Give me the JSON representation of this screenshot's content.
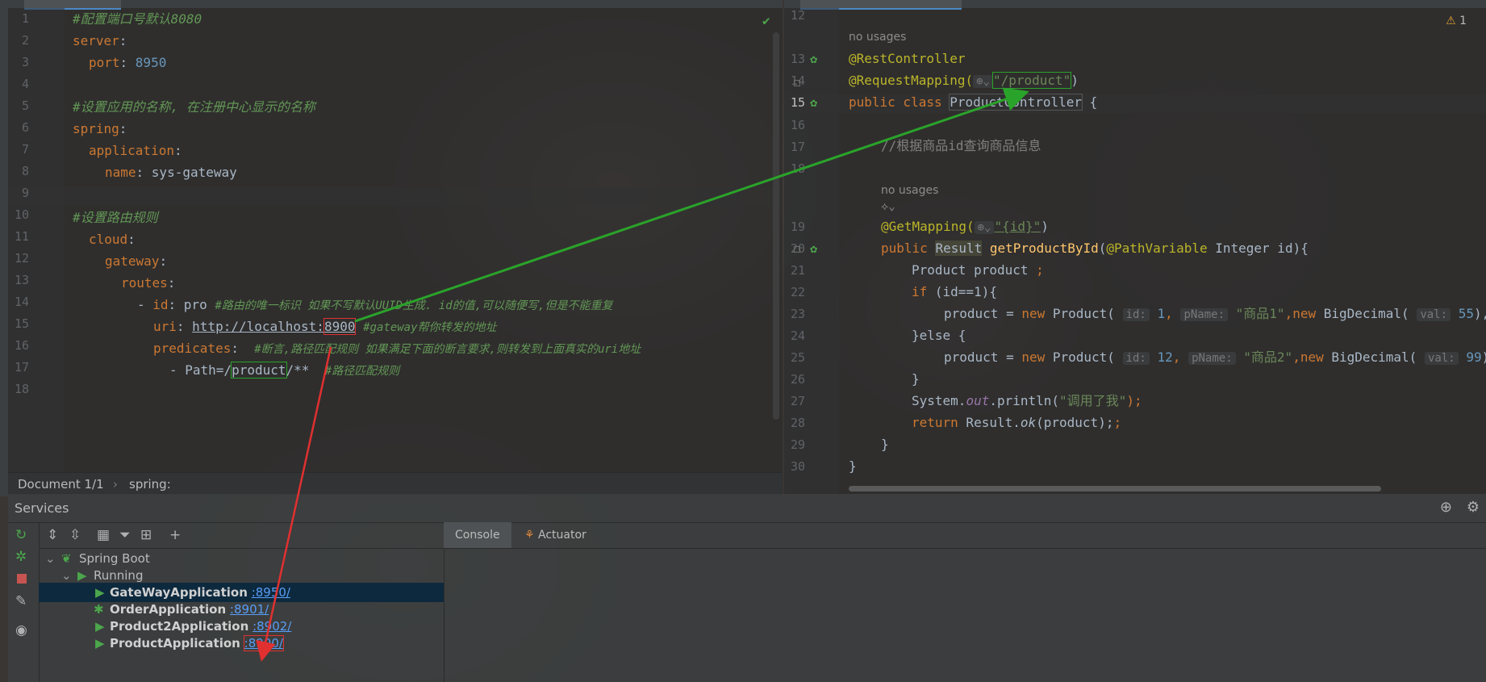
{
  "left_editor": {
    "line_numbers": [
      "1",
      "2",
      "3",
      "4",
      "5",
      "6",
      "7",
      "8",
      "9",
      "10",
      "11",
      "12",
      "13",
      "14",
      "15",
      "16",
      "17",
      "18"
    ],
    "l1_comment": "#配置端口号默认8080",
    "l2_key": "server",
    "l3_key": "port",
    "l3_value": "8950",
    "l5_comment": "#设置应用的名称, 在注册中心显示的名称",
    "l6_key": "spring",
    "l7_key": "application",
    "l8_key": "name",
    "l8_value": "sys-gateway",
    "l10_comment": "#设置路由规则",
    "l11_key": "cloud",
    "l12_key": "gateway",
    "l13_key": "routes",
    "l14_dash": "- ",
    "l14_key": "id",
    "l14_value": "pro",
    "l14_comment": "#路由的唯一标识 如果不写默认UUID生成. id的值,可以随便写,但是不能重复",
    "l15_key": "uri",
    "l15_url_prefix": "http://localhost:",
    "l15_port": "8900",
    "l15_comment": "#gateway帮你转发的地址",
    "l16_key": "predicates",
    "l16_comment": "#断言,路径匹配规则 如果满足下面的断言要求,则转发到上面真实的uri地址",
    "l17_prefix": "- Path=/",
    "l17_path": "product",
    "l17_suffix": "/**",
    "l17_comment": "#路径匹配规则"
  },
  "breadcrumb": {
    "document": "Document 1/1",
    "separator": "›",
    "section": "spring:"
  },
  "right_editor": {
    "warning_count": "1",
    "line_numbers": {
      "l12": "12",
      "l13": "13",
      "l14": "14",
      "l15": "15",
      "l16": "16",
      "l17": "17",
      "l18": "18",
      "l19": "19",
      "l20": "20",
      "l21": "21",
      "l22": "22",
      "l23": "23",
      "l24": "24",
      "l25": "25",
      "l26": "26",
      "l27": "27",
      "l28": "28",
      "l29": "29",
      "l30": "30"
    },
    "no_usages": "no usages",
    "no_usages_2": "no usages",
    "rest_controller": "@RestController",
    "request_mapping": "@RequestMapping(",
    "request_mapping_path": "\"/product\"",
    "request_mapping_close": ")",
    "class_kw": "public class ",
    "class_name": "ProductController",
    "class_open": " {",
    "comment_query": "//根据商品id查询商品信息",
    "get_mapping": "@GetMapping(",
    "get_mapping_path": "\"{id}\"",
    "get_mapping_close": ")",
    "l20_public": "public ",
    "l20_type": "Result",
    "l20_method": "getProductById",
    "l20_params_a": "(",
    "l20_ann": "@PathVariable",
    "l20_params_b": " Integer id){",
    "l21_text": "Product product ",
    "l21_semicolon": ";",
    "l22_if": "if",
    "l22_rest": " (id==1){",
    "l23_lead": "product = ",
    "l23_new": "new",
    "l23_ctor": " Product(",
    "l23_hint_id": "id:",
    "l23_id": "1",
    "l23_hint_pname": "pName:",
    "l23_str": "\"商品1\"",
    "l23_new2": ",new",
    "l23_bd": " BigDecimal(",
    "l23_hint_val": "val:",
    "l23_val": "55",
    "l23_tail": "), in",
    "l24_text": "}else {",
    "l25_lead": "product = ",
    "l25_new": "new",
    "l25_ctor": " Product(",
    "l25_hint_id": "id:",
    "l25_id": "12",
    "l25_hint_pname": "pName:",
    "l25_str": "\"商品2\"",
    "l25_new2": ",new",
    "l25_bd": " BigDecimal(",
    "l25_hint_val": "val:",
    "l25_val": "99",
    "l25_tail": "),",
    "l26_text": "}",
    "l27_a": "System.",
    "l27_out": "out",
    "l27_b": ".println(",
    "l27_str": "\"调用了我\"",
    "l27_c": ");",
    "l28_return": "return",
    "l28_a": " Result.",
    "l28_ok": "ok",
    "l28_b": "(product);",
    "l29_text": "}",
    "l30_text": "}"
  },
  "services": {
    "title": "Services",
    "tree": [
      {
        "label": "Spring Boot"
      },
      {
        "label": "Running"
      },
      {
        "name": "GateWayApplication",
        "port": ":8950/"
      },
      {
        "name": "OrderApplication",
        "port": ":8901/"
      },
      {
        "name": "Product2Application",
        "port": ":8902/"
      },
      {
        "name": "ProductApplication",
        "port": ":8900/"
      }
    ],
    "tabs": {
      "console": "Console",
      "actuator": "Actuator"
    }
  },
  "colors": {
    "annotation_red": "#e03030",
    "annotation_green": "#2aa32a",
    "selected_row": "#0d293e"
  }
}
